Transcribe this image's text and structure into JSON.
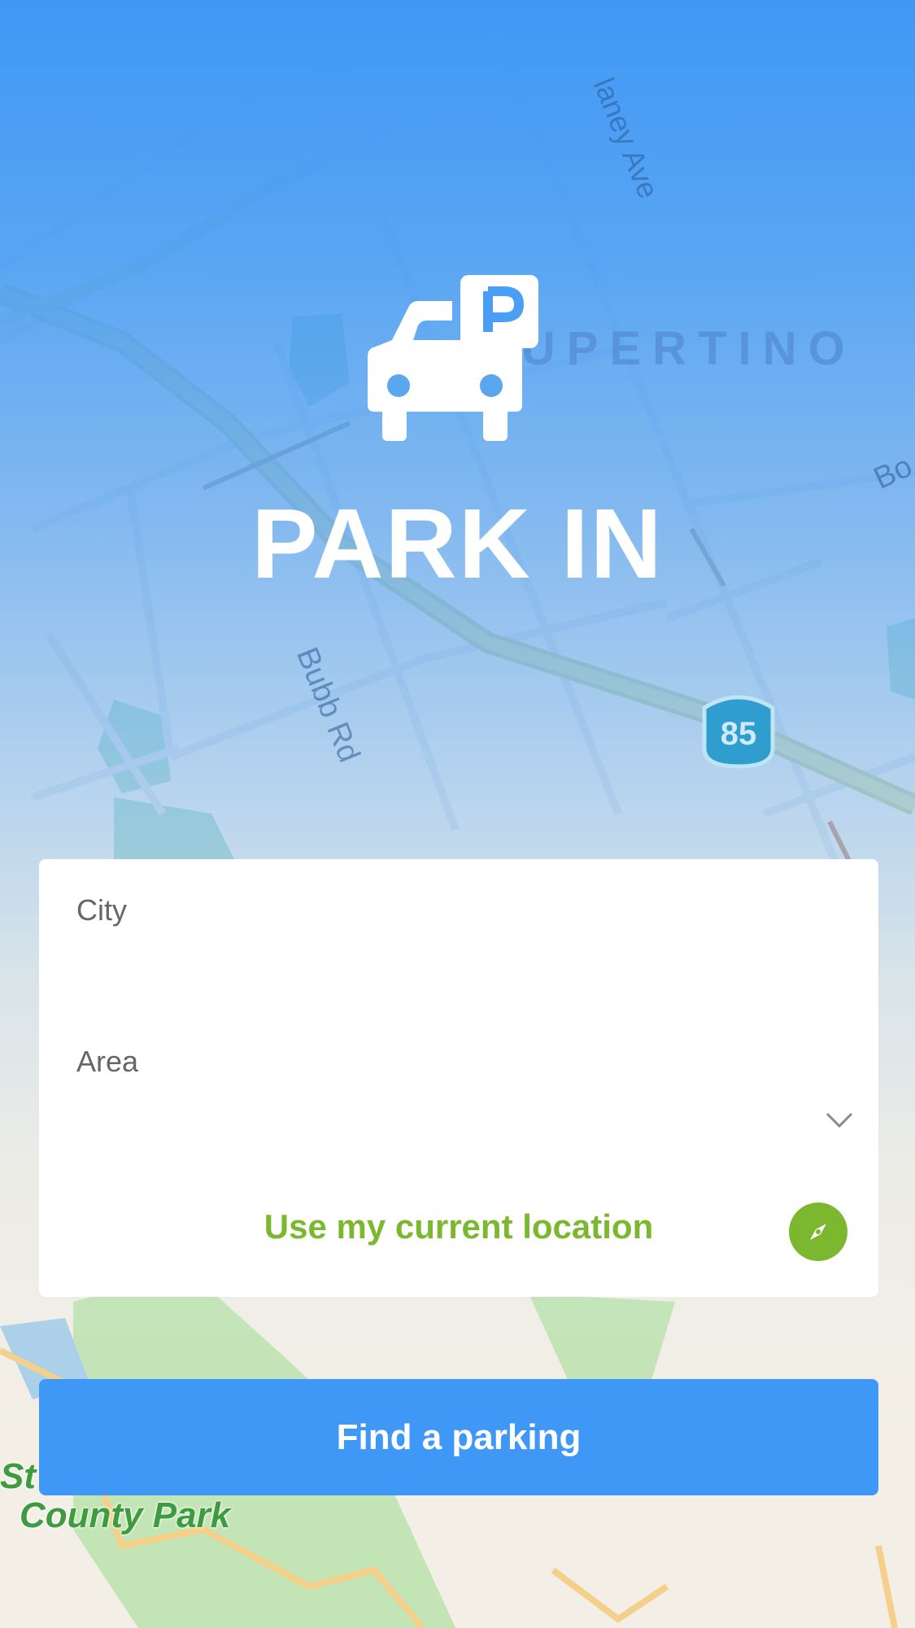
{
  "app": {
    "title": "PARK IN",
    "logo_icon": "car-parking-icon"
  },
  "map": {
    "labels": {
      "cupertino": "CUPERTINO",
      "bubb": "Bubb Rd",
      "ave": "laney Ave",
      "bo": "Bo",
      "st": "St",
      "county_park": "County Park"
    },
    "highway_shield": "85"
  },
  "form": {
    "city": {
      "label": "City",
      "value": "",
      "placeholder": ""
    },
    "area": {
      "label": "Area",
      "value": "",
      "icon": "chevron-down-icon"
    },
    "location": {
      "label": "Use my current location",
      "icon": "compass-icon"
    }
  },
  "actions": {
    "find": "Find a parking"
  },
  "colors": {
    "primary": "#3f98f6",
    "accent_green": "#7cb82f",
    "label_gray": "#666666",
    "white": "#ffffff"
  }
}
